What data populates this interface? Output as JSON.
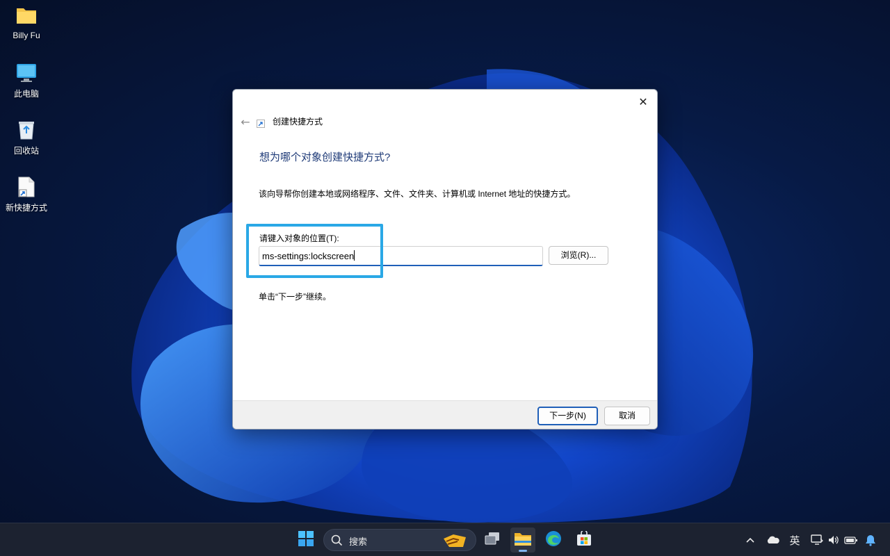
{
  "desktop": {
    "icons": [
      {
        "label": "Billy Fu",
        "icon": "folder-icon"
      },
      {
        "label": "此电脑",
        "icon": "computer-icon"
      },
      {
        "label": "回收站",
        "icon": "recycle-bin-icon"
      },
      {
        "label": "新快捷方式",
        "icon": "shortcut-file-icon"
      }
    ]
  },
  "dialog": {
    "title": "创建快捷方式",
    "close_glyph": "✕",
    "back_glyph": "←",
    "heading": "想为哪个对象创建快捷方式?",
    "description": "该向导帮你创建本地或网络程序、文件、文件夹、计算机或 Internet 地址的快捷方式。",
    "location_label": "请键入对象的位置(T):",
    "location_value": "ms-settings:lockscreen",
    "browse_label": "浏览(R)...",
    "hint": "单击“下一步”继续。",
    "next_label": "下一步(N)",
    "cancel_label": "取消",
    "highlight_color": "#2aa8e6",
    "accent": "#1f5fb8"
  },
  "taskbar": {
    "search_placeholder": "搜索",
    "apps": [
      {
        "name": "start-button",
        "icon": "windows-logo-icon"
      },
      {
        "name": "task-view-button",
        "icon": "task-view-icon"
      },
      {
        "name": "file-explorer-button",
        "icon": "folder-icon",
        "active": true
      },
      {
        "name": "edge-button",
        "icon": "edge-icon"
      },
      {
        "name": "store-button",
        "icon": "store-icon"
      }
    ],
    "tray": {
      "ime_label": "英",
      "icons": [
        "chevron-up-icon",
        "onedrive-icon",
        "ime-icon",
        "network-icon",
        "volume-icon",
        "battery-icon",
        "notification-icon"
      ]
    }
  }
}
